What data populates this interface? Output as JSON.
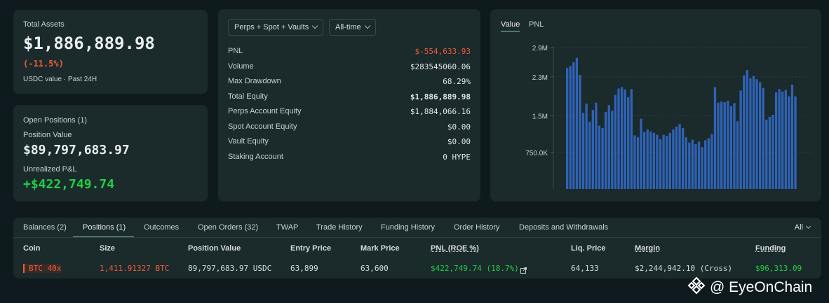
{
  "assets": {
    "label": "Total Assets",
    "value": "$1,886,889.98",
    "change": "(-11.5%)",
    "sub": "USDC value · Past 24H"
  },
  "positions": {
    "label": "Open Positions (1)",
    "position_value_label": "Position Value",
    "position_value": "$89,797,683.97",
    "pnl_label": "Unrealized P&L",
    "pnl": "+$422,749.74"
  },
  "stats": {
    "filter_scope": "Perps + Spot + Vaults",
    "filter_time": "All-time",
    "rows": [
      {
        "label": "PNL",
        "value": "$-554,633.93"
      },
      {
        "label": "Volume",
        "value": "$283545060.06"
      },
      {
        "label": "Max Drawdown",
        "value": "68.29%"
      },
      {
        "label": "Total Equity",
        "value": "$1,886,889.98"
      },
      {
        "label": "Perps Account Equity",
        "value": "$1,884,066.16"
      },
      {
        "label": "Spot Account Equity",
        "value": "$0.00"
      },
      {
        "label": "Vault Equity",
        "value": "$0.00"
      },
      {
        "label": "Staking Account",
        "value": "0 HYPE"
      }
    ]
  },
  "chart_tabs": [
    "Value",
    "PNL"
  ],
  "chart_data": {
    "type": "bar",
    "yticks": [
      "2.9M",
      "2.3M",
      "1.5M",
      "750.0K"
    ],
    "ylim": [
      0,
      2900000
    ],
    "color": "#2f63b7",
    "values": [
      2480000,
      2520000,
      2600000,
      2690000,
      2340000,
      1560000,
      1750000,
      1380000,
      1620000,
      1770000,
      1300000,
      1250000,
      1580000,
      1720000,
      1600000,
      1930000,
      2060000,
      2090000,
      2040000,
      1880000,
      2050000,
      1100000,
      1060000,
      1440000,
      1170000,
      1220000,
      1180000,
      1150000,
      1110000,
      1020000,
      1110000,
      1090000,
      1150000,
      1220000,
      1280000,
      1330000,
      1250000,
      1060000,
      950000,
      1010000,
      920000,
      970000,
      860000,
      1000000,
      1040000,
      1120000,
      2090000,
      1770000,
      1790000,
      1780000,
      1810000,
      1700000,
      1760000,
      1390000,
      2020000,
      2330000,
      2440000,
      2270000,
      2320000,
      2250000,
      2190000,
      2070000,
      1420000,
      1480000,
      1520000,
      1980000,
      2050000,
      2000000,
      2030000,
      1900000,
      2140000,
      1900000
    ]
  },
  "table": {
    "tabs": [
      "Balances (2)",
      "Positions (1)",
      "Outcomes",
      "Open Orders (32)",
      "TWAP",
      "Trade History",
      "Funding History",
      "Order History",
      "Deposits and Withdrawals"
    ],
    "filter": "All",
    "columns": [
      "Coin",
      "Size",
      "Position Value",
      "Entry Price",
      "Mark Price",
      "PNL (ROE %)",
      "Liq. Price",
      "Margin",
      "Funding"
    ],
    "row": {
      "coin": "BTC 40x",
      "size": "1,411.91327 BTC",
      "position_value": "89,797,683.97 USDC",
      "entry_price": "63,899",
      "mark_price": "63,600",
      "pnl": "$422,749.74 (18.7%)",
      "liq_price": "64,133",
      "margin": "$2,244,942.10 (Cross)",
      "funding": "$96,313.09"
    }
  },
  "watermark": "@ EyeOnChain",
  "colors": {
    "accent": "#7fc9b8",
    "negative": "#ef5b3f",
    "positive": "#1fd145",
    "bar": "#2f63b7"
  }
}
